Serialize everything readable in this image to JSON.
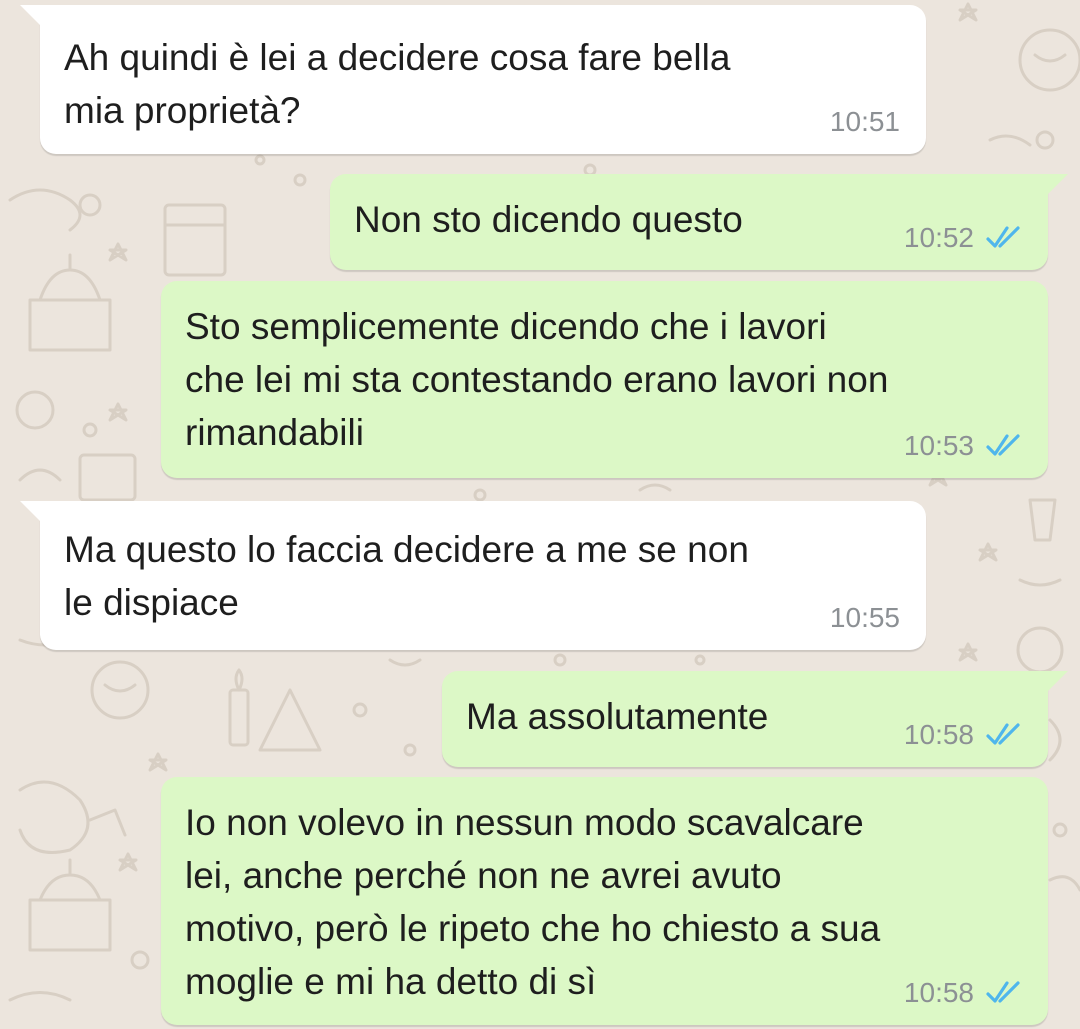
{
  "chat": {
    "messages": [
      {
        "direction": "in",
        "text": "Ah quindi è lei a decidere cosa fare bella\nmia proprietà?",
        "time": "10:51"
      },
      {
        "direction": "out",
        "text": "Non sto dicendo questo",
        "time": "10:52",
        "status": "read"
      },
      {
        "direction": "out",
        "text": "Sto semplicemente dicendo che i lavori\nche lei mi sta contestando erano lavori non\nrimandabili",
        "time": "10:53",
        "status": "read"
      },
      {
        "direction": "in",
        "text": "Ma questo lo faccia decidere a me se non\nle dispiace",
        "time": "10:55"
      },
      {
        "direction": "out",
        "text": "Ma assolutamente",
        "time": "10:58",
        "status": "read"
      },
      {
        "direction": "out",
        "text": "Io non volevo in nessun modo scavalcare\nlei, anche perché non ne avrei avuto\nmotivo, però le ripeto che ho chiesto a sua\nmoglie e mi ha detto di sì",
        "time": "10:58",
        "status": "read"
      }
    ]
  },
  "colors": {
    "background": "#ece5dd",
    "incoming_bubble": "#ffffff",
    "outgoing_bubble": "#dcf8c6",
    "read_ticks": "#4fb6ec",
    "timestamp": "#8c9094"
  },
  "icons": {
    "read_receipt": "double-check-icon"
  }
}
